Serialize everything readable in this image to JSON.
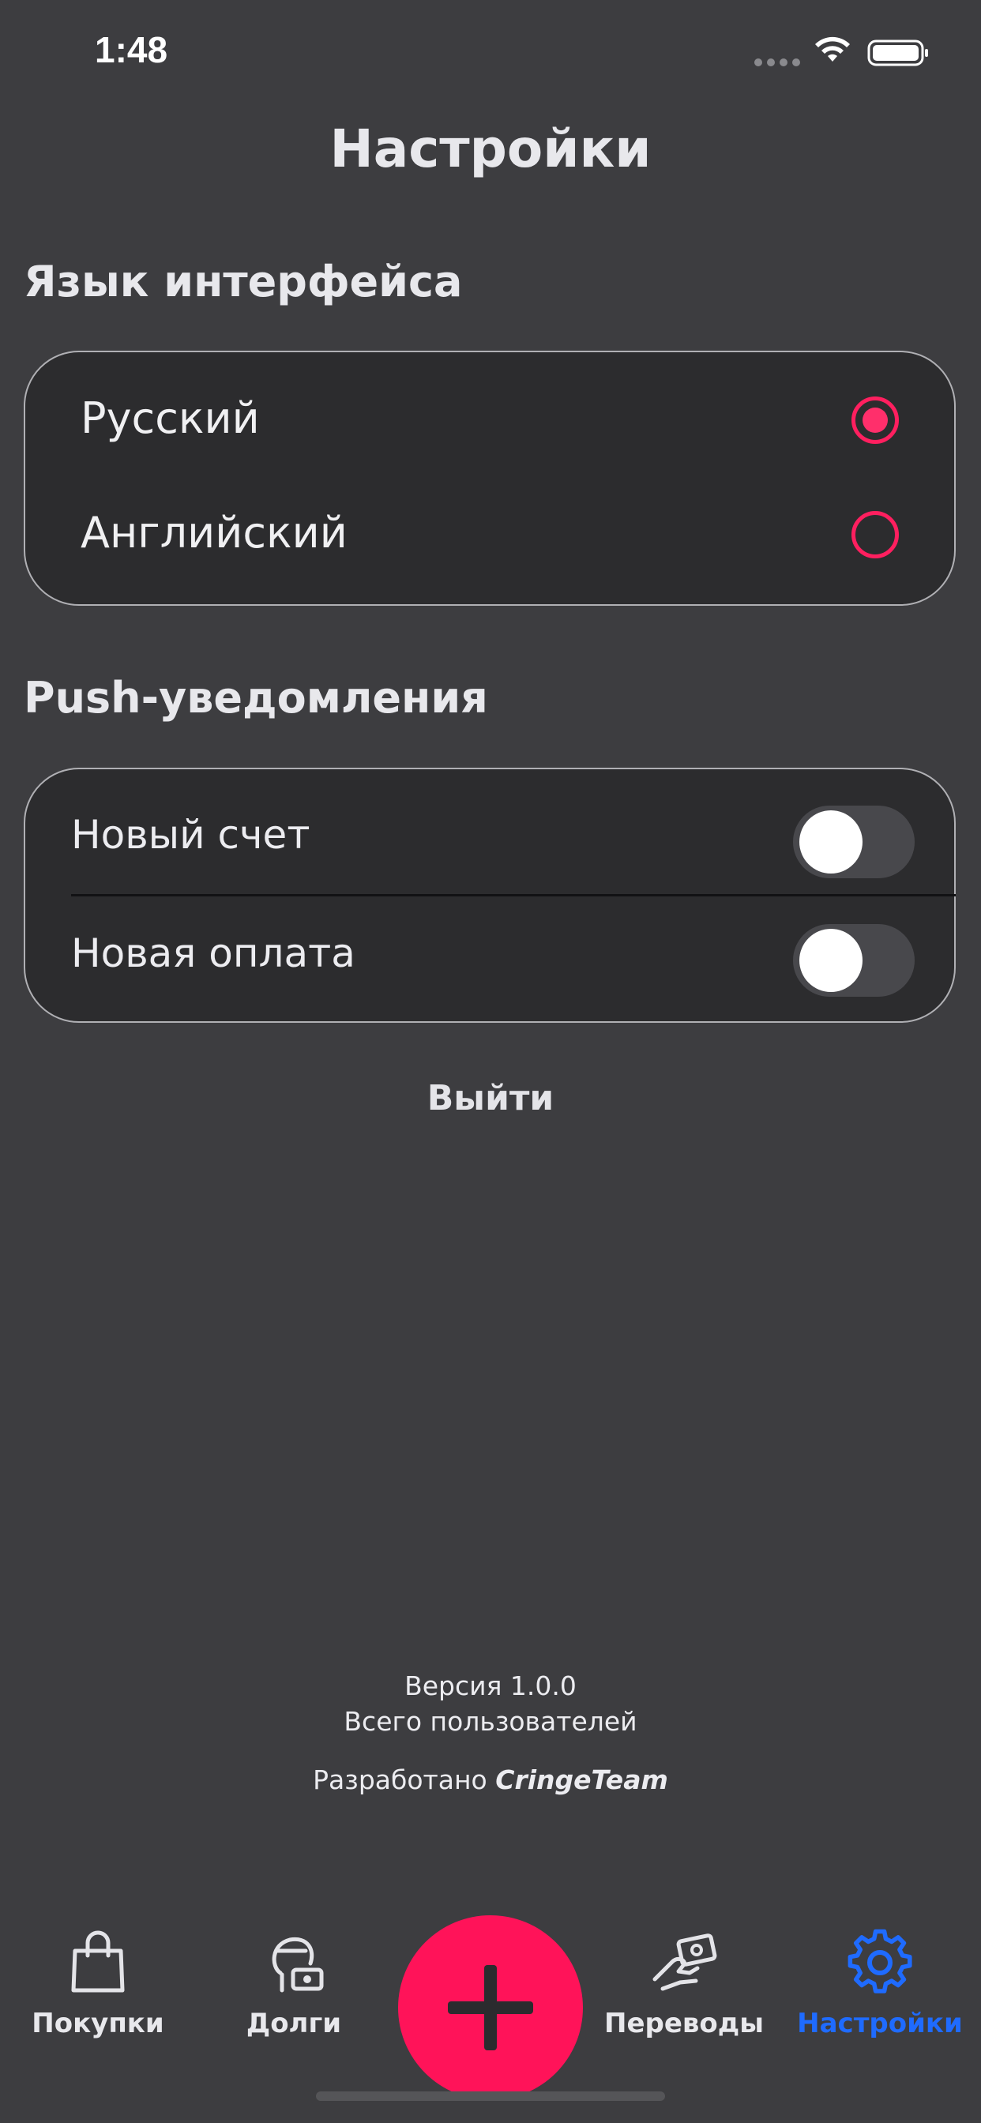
{
  "status_bar": {
    "time": "1:48"
  },
  "page_title": "Настройки",
  "language_section": {
    "title": "Язык интерфейса",
    "options": [
      {
        "label": "Русский",
        "selected": true
      },
      {
        "label": "Английский",
        "selected": false
      }
    ]
  },
  "push_section": {
    "title": "Push-уведомления",
    "toggles": [
      {
        "label": "Новый счет",
        "on": false
      },
      {
        "label": "Новая оплата",
        "on": false
      }
    ]
  },
  "logout_label": "Выйти",
  "footer": {
    "version": "Версия 1.0.0",
    "users": "Всего пользователей",
    "developed_by_prefix": "Разработано",
    "developer": "CringeTeam"
  },
  "tab_bar": {
    "tabs": [
      {
        "label": "Покупки",
        "icon": "shopping-bag-icon"
      },
      {
        "label": "Долги",
        "icon": "debt-person-icon"
      },
      {
        "label": "Переводы",
        "icon": "transfer-hand-icon"
      },
      {
        "label": "Настройки",
        "icon": "gear-icon"
      }
    ],
    "active": "Настройки",
    "fab_icon": "plus-icon"
  },
  "colors": {
    "background": "#3d3d40",
    "card": "#2c2c2e",
    "accent_pink": "#ff1359",
    "active_blue": "#1f6bff"
  }
}
